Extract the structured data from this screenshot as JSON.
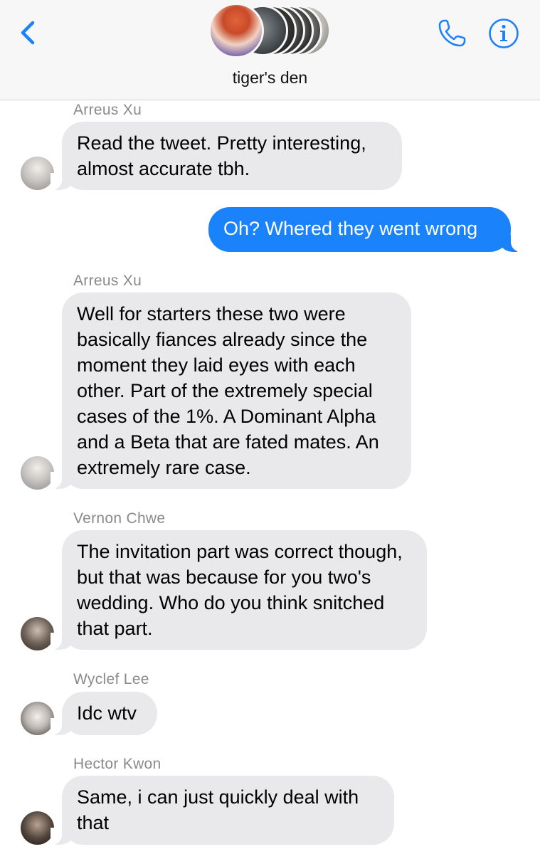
{
  "header": {
    "title": "tiger's den",
    "back_icon": "chevron-left-icon",
    "call_icon": "phone-icon",
    "info_icon": "info-icon",
    "accent_color": "#1a82fb"
  },
  "messages": [
    {
      "sender": "Arreus Xu",
      "direction": "incoming",
      "text": "Read the tweet. Pretty interesting, almost accurate tbh."
    },
    {
      "sender": "",
      "direction": "outgoing",
      "text": "Oh? Whered they went wrong"
    },
    {
      "sender": "Arreus Xu",
      "direction": "incoming",
      "text": "Well for starters these two were basically fiances already since the moment they laid eyes with each other. Part of the extremely special cases of the 1%. A Dominant Alpha and a Beta that are fated mates. An extremely rare case."
    },
    {
      "sender": "Vernon Chwe",
      "direction": "incoming",
      "text": "The invitation part was correct though, but that was because for you two's wedding. Who do you think snitched that part."
    },
    {
      "sender": "Wyclef Lee",
      "direction": "incoming",
      "text": "Idc wtv"
    },
    {
      "sender": "Hector Kwon",
      "direction": "incoming",
      "text": "Same, i can just quickly deal with that"
    }
  ]
}
